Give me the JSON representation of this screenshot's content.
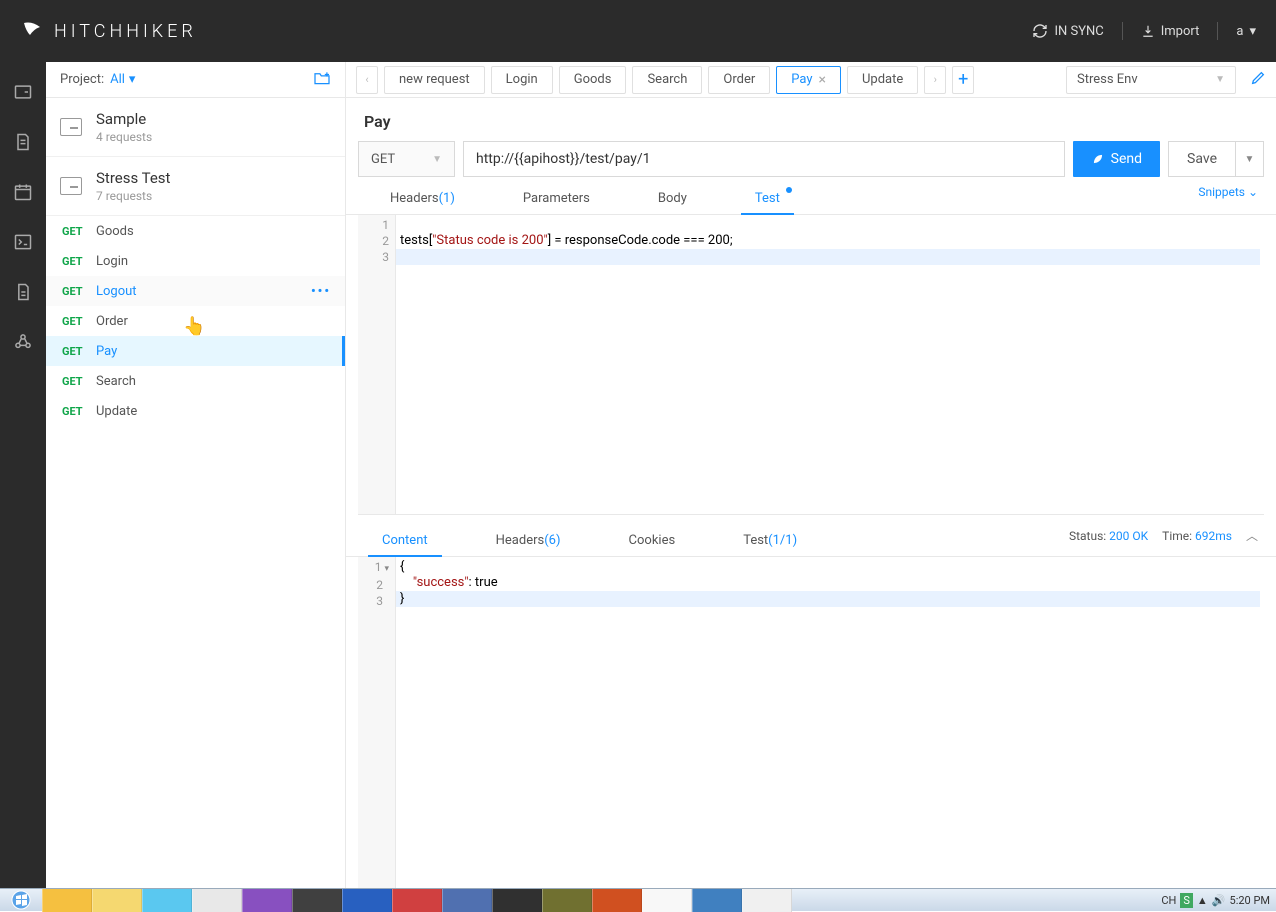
{
  "header": {
    "brand": "HITCHHIKER",
    "sync": "IN SYNC",
    "import": "Import",
    "user": "a"
  },
  "sidebar": {
    "projectLabel": "Project:",
    "projectValue": "All",
    "collections": [
      {
        "name": "Sample",
        "sub": "4 requests"
      },
      {
        "name": "Stress Test",
        "sub": "7 requests"
      }
    ],
    "requests": [
      {
        "method": "GET",
        "name": "Goods"
      },
      {
        "method": "GET",
        "name": "Login"
      },
      {
        "method": "GET",
        "name": "Logout",
        "hover": true
      },
      {
        "method": "GET",
        "name": "Order"
      },
      {
        "method": "GET",
        "name": "Pay",
        "active": true
      },
      {
        "method": "GET",
        "name": "Search"
      },
      {
        "method": "GET",
        "name": "Update"
      }
    ]
  },
  "tabs": [
    "new request",
    "Login",
    "Goods",
    "Search",
    "Order",
    "Pay",
    "Update"
  ],
  "activeTab": "Pay",
  "env": "Stress Env",
  "requestName": "Pay",
  "method": "GET",
  "url": "http://{{apihost}}/test/pay/1",
  "sendLabel": "Send",
  "saveLabel": "Save",
  "reqTabs": {
    "headers": "Headers",
    "headersCount": "(1)",
    "parameters": "Parameters",
    "body": "Body",
    "test": "Test",
    "snippets": "Snippets"
  },
  "testCode": {
    "prefix": "tests[",
    "string": "\"Status code is 200\"",
    "suffix": "] = responseCode.code === 200;"
  },
  "respTabs": {
    "content": "Content",
    "headers": "Headers",
    "headersCount": "(6)",
    "cookies": "Cookies",
    "test": "Test",
    "testCount": "(1/1)"
  },
  "respMeta": {
    "statusLabel": "Status:",
    "statusValue": "200 OK",
    "timeLabel": "Time:",
    "timeValue": "692ms"
  },
  "respBody": {
    "l1": "{",
    "l2_key": "\"success\"",
    "l2_rest": ": true",
    "l3": "}"
  },
  "taskbar": {
    "lang": "CH",
    "time": "5:20 PM"
  }
}
